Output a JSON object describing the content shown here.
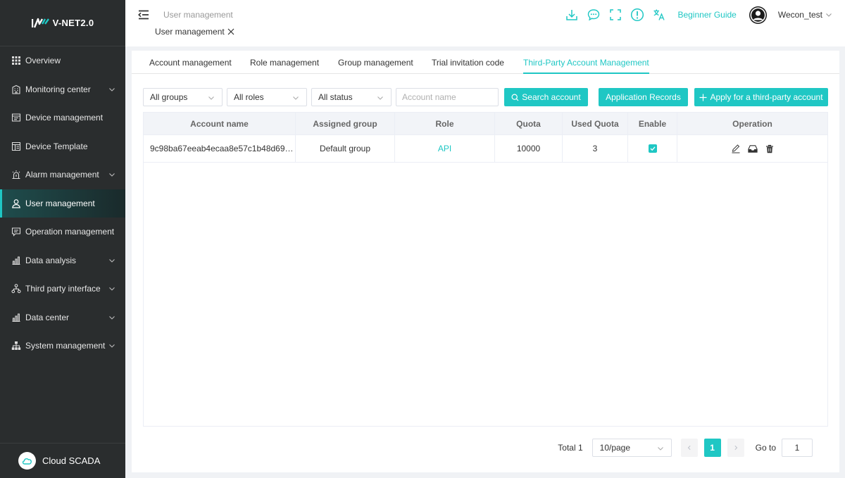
{
  "brand": {
    "logo_text": "V-NET2.0",
    "footer_label": "Cloud SCADA"
  },
  "sidebar": {
    "items": [
      {
        "label": "Overview",
        "icon": "grid-icon",
        "arrow": false
      },
      {
        "label": "Monitoring center",
        "icon": "building-icon",
        "arrow": true
      },
      {
        "label": "Device management",
        "icon": "device-icon",
        "arrow": false
      },
      {
        "label": "Device Template",
        "icon": "template-icon",
        "arrow": false
      },
      {
        "label": "Alarm management",
        "icon": "alarm-icon",
        "arrow": true
      },
      {
        "label": "User management",
        "icon": "user-icon",
        "arrow": false,
        "active": true
      },
      {
        "label": "Operation management",
        "icon": "message-icon",
        "arrow": false
      },
      {
        "label": "Data analysis",
        "icon": "bar-chart-icon",
        "arrow": true
      },
      {
        "label": "Third party interface",
        "icon": "network-icon",
        "arrow": true
      },
      {
        "label": "Data center",
        "icon": "bar-chart-icon",
        "arrow": true
      },
      {
        "label": "System management",
        "icon": "org-chart-icon",
        "arrow": true
      }
    ]
  },
  "header": {
    "breadcrumb": "User management",
    "page_tab": "User management",
    "guide": "Beginner Guide",
    "username": "Wecon_test"
  },
  "tabs": [
    {
      "label": "Account management"
    },
    {
      "label": "Role management"
    },
    {
      "label": "Group management"
    },
    {
      "label": "Trial invitation code"
    },
    {
      "label": "Third-Party Account Management",
      "active": true
    }
  ],
  "filters": {
    "group": "All groups",
    "role": "All roles",
    "status": "All status",
    "account_placeholder": "Account name",
    "search_btn": "Search account",
    "records_btn": "Application Records",
    "apply_btn": "Apply for a third-party account"
  },
  "table": {
    "headers": [
      "Account name",
      "Assigned group",
      "Role",
      "Quota",
      "Used Quota",
      "Enable",
      "Operation"
    ],
    "rows": [
      {
        "account": "9c98ba67eeab4ecaa8e57c1b48d69…",
        "group": "Default group",
        "role": "API",
        "quota": "10000",
        "used": "3",
        "enabled": true
      }
    ]
  },
  "pagination": {
    "total": "Total 1",
    "page_size": "10/page",
    "current": "1",
    "goto_label": "Go to",
    "goto_value": "1"
  },
  "colors": {
    "accent": "#1fc7c4",
    "sidebar_bg": "#2a2d2e"
  }
}
